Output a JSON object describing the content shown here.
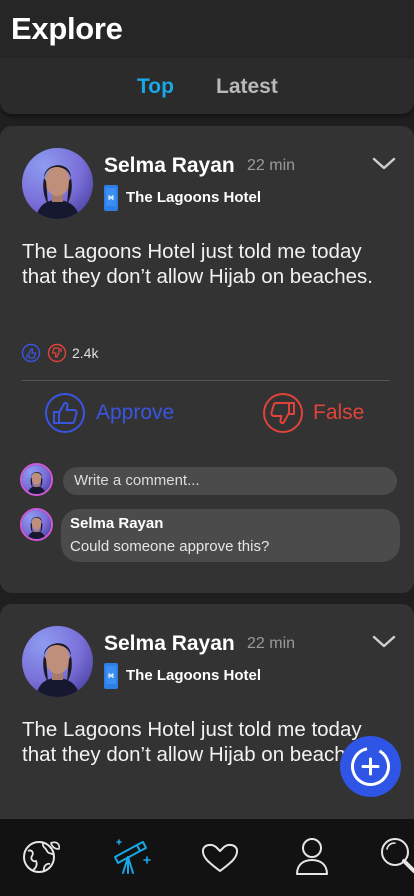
{
  "header": {
    "title": "Explore"
  },
  "tabs": [
    {
      "label": "Top",
      "active": true
    },
    {
      "label": "Latest",
      "active": false
    }
  ],
  "posts": [
    {
      "author": "Selma Rayan",
      "time": "22 min",
      "hotel": "The Lagoons Hotel",
      "text": "The Lagoons Hotel just told me today that they don’t allow Hijab on beaches.",
      "reaction_count": "2.4k",
      "approve_label": "Approve",
      "false_label": "False",
      "comment_placeholder": "Write a comment...",
      "comments": [
        {
          "author": "Selma Rayan",
          "text": "Could someone approve this?"
        }
      ]
    },
    {
      "author": "Selma Rayan",
      "time": "22 min",
      "hotel": "The Lagoons Hotel",
      "text": "The Lagoons Hotel just told me today that they don’t allow Hijab on beaches."
    }
  ],
  "bottom_nav": [
    {
      "icon": "globe-icon",
      "active": false
    },
    {
      "icon": "telescope-icon",
      "active": true
    },
    {
      "icon": "heart-icon",
      "active": false
    },
    {
      "icon": "user-icon",
      "active": false
    },
    {
      "icon": "search-icon",
      "active": false
    }
  ],
  "colors": {
    "accent": "#1aa7e8",
    "approve": "#3a55e0",
    "false": "#e0433a",
    "fab": "#2f55e6",
    "card": "#333333",
    "background": "#1f1f1f"
  }
}
